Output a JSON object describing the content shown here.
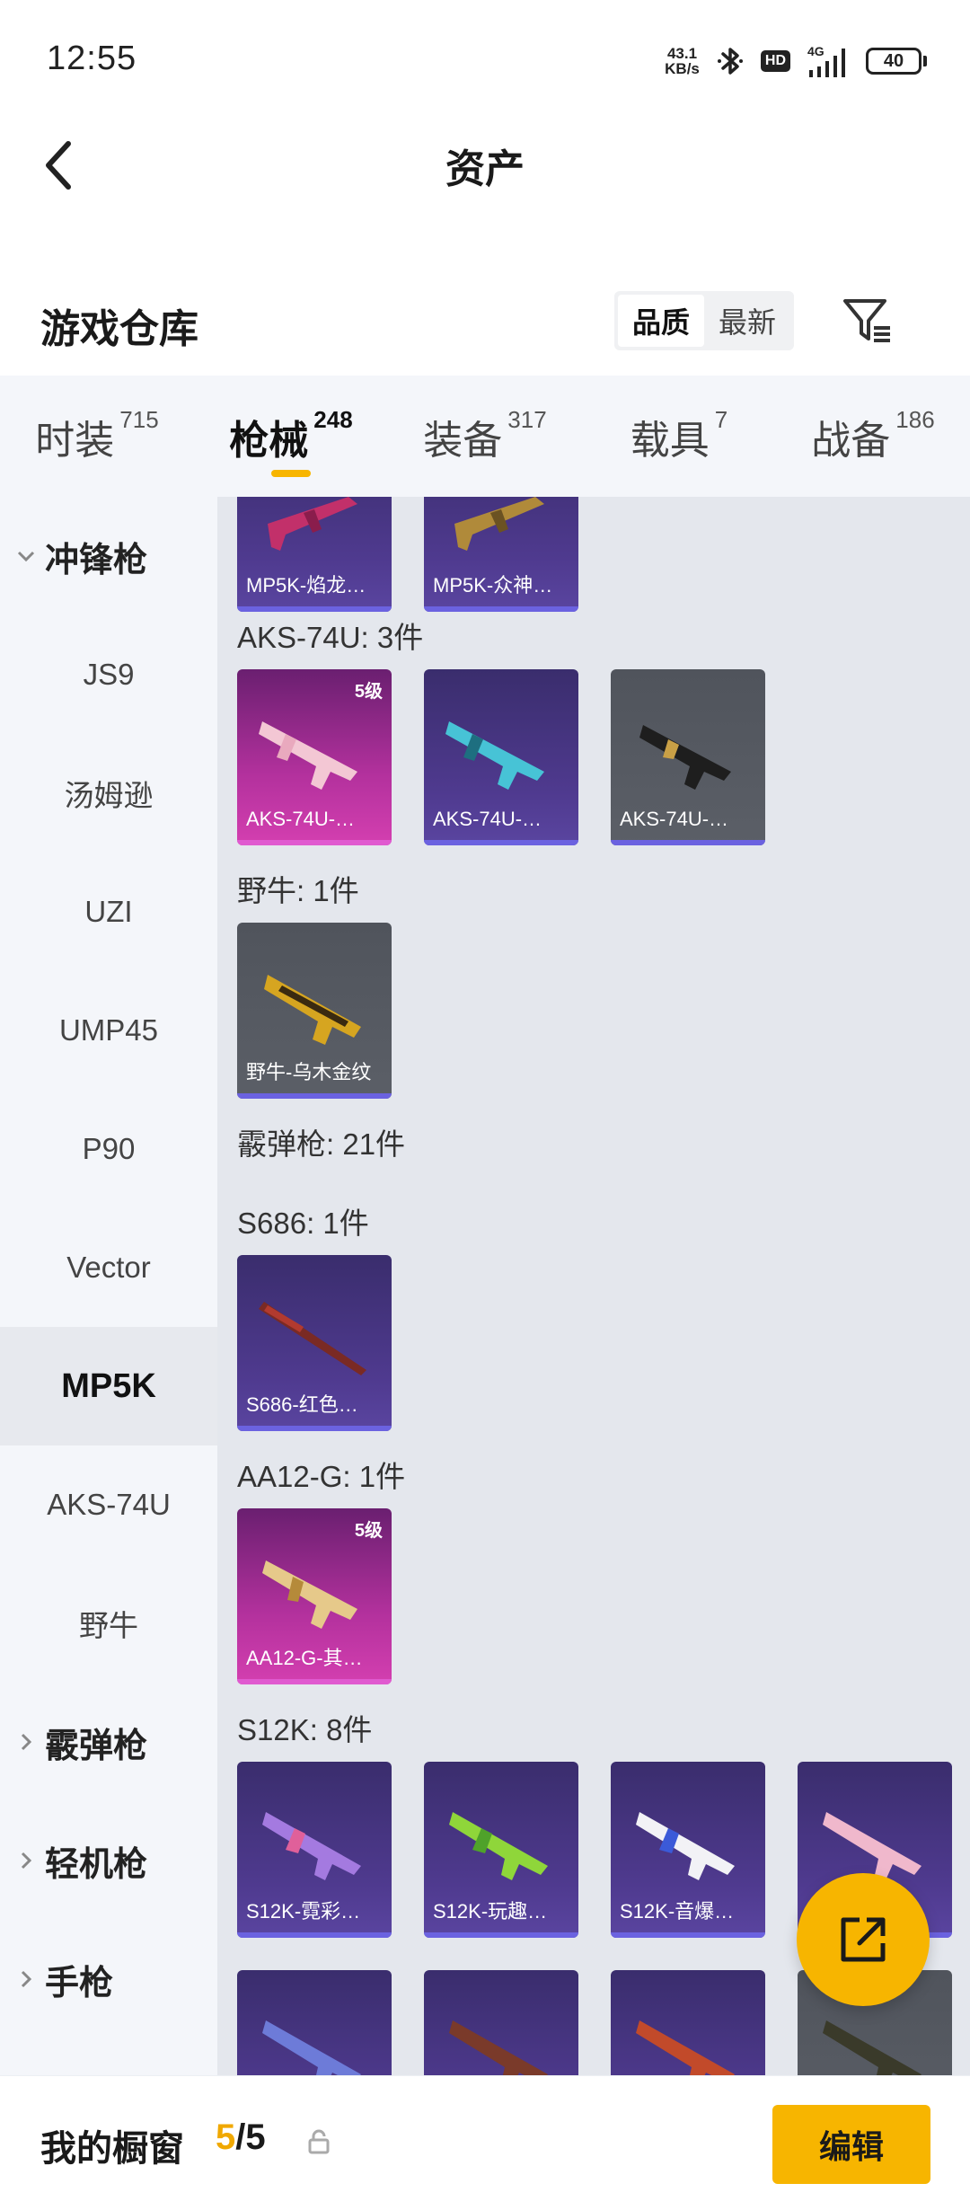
{
  "status_bar": {
    "time": "12:55",
    "net_speed_value": "43.1",
    "net_speed_unit": "KB/s",
    "hd_label": "HD",
    "network_label": "4G",
    "battery": "40"
  },
  "header": {
    "title": "资产"
  },
  "warehouse": {
    "title": "游戏仓库",
    "sort_options": [
      "品质",
      "最新"
    ],
    "active_sort": "品质"
  },
  "category_tabs": [
    {
      "label": "时装",
      "count": "715",
      "active": false
    },
    {
      "label": "枪械",
      "count": "248",
      "active": true
    },
    {
      "label": "装备",
      "count": "317",
      "active": false
    },
    {
      "label": "载具",
      "count": "7",
      "active": false
    },
    {
      "label": "战备",
      "count": "186",
      "active": false
    }
  ],
  "sidebar": {
    "items": [
      {
        "label": "冲锋枪",
        "type": "group",
        "expanded": true
      },
      {
        "label": "JS9",
        "type": "sub"
      },
      {
        "label": "汤姆逊",
        "type": "sub"
      },
      {
        "label": "UZI",
        "type": "sub"
      },
      {
        "label": "UMP45",
        "type": "sub"
      },
      {
        "label": "P90",
        "type": "sub"
      },
      {
        "label": "Vector",
        "type": "sub"
      },
      {
        "label": "MP5K",
        "type": "sub",
        "active": true
      },
      {
        "label": "AKS-74U",
        "type": "sub"
      },
      {
        "label": "野牛",
        "type": "sub"
      },
      {
        "label": "霰弹枪",
        "type": "group",
        "expanded": false
      },
      {
        "label": "轻机枪",
        "type": "group",
        "expanded": false
      },
      {
        "label": "手枪",
        "type": "group",
        "expanded": false
      }
    ]
  },
  "content": {
    "sections": [
      {
        "label": "AKS-74U: 3件"
      },
      {
        "label": "野牛: 1件"
      },
      {
        "label": "霰弹枪: 21件"
      },
      {
        "label": "S686: 1件"
      },
      {
        "label": "AA12-G: 1件"
      },
      {
        "label": "S12K: 8件"
      }
    ],
    "items": [
      {
        "name": "MP5K-焰龙…",
        "level": ""
      },
      {
        "name": "MP5K-众神…",
        "level": ""
      },
      {
        "name": "AKS-74U-…",
        "level": "5级"
      },
      {
        "name": "AKS-74U-…",
        "level": ""
      },
      {
        "name": "AKS-74U-…",
        "level": ""
      },
      {
        "name": "野牛-乌木金纹",
        "level": ""
      },
      {
        "name": "S686-红色…",
        "level": ""
      },
      {
        "name": "AA12-G-其…",
        "level": "5级"
      },
      {
        "name": "S12K-霓彩…",
        "level": ""
      },
      {
        "name": "S12K-玩趣…",
        "level": ""
      },
      {
        "name": "S12K-音爆…",
        "level": ""
      },
      {
        "name": "",
        "level": ""
      },
      {
        "name": "",
        "level": ""
      },
      {
        "name": "",
        "level": ""
      },
      {
        "name": "",
        "level": ""
      },
      {
        "name": "",
        "level": ""
      }
    ]
  },
  "bottom_bar": {
    "window_label": "我的橱窗",
    "window_used": "5",
    "window_total": "/5",
    "edit_label": "编辑"
  },
  "icons": {
    "back": "back-arrow-icon",
    "filter": "filter-icon",
    "share": "share-icon",
    "lock": "lock-icon",
    "accent_color": "#f7b500"
  }
}
